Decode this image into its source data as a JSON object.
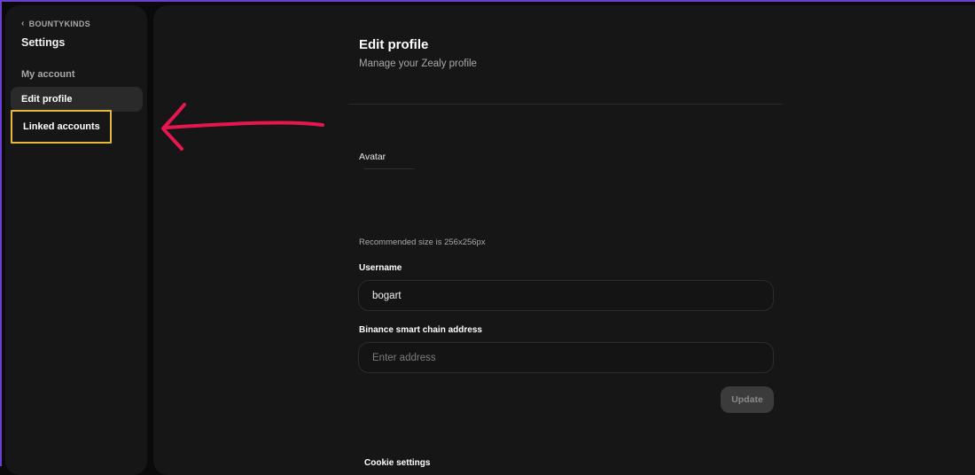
{
  "sidebar": {
    "back_label": "BOUNTYKINDS",
    "title": "Settings",
    "items": [
      {
        "label": "My account"
      },
      {
        "label": "Edit profile"
      },
      {
        "label": "Linked accounts"
      }
    ]
  },
  "main": {
    "title": "Edit profile",
    "subtitle": "Manage your Zealy profile",
    "avatar_label": "Avatar",
    "recommended_size": "Recommended size is 256x256px",
    "username": {
      "label": "Username",
      "value": "bogart"
    },
    "bsc_address": {
      "label": "Binance smart chain address",
      "placeholder": "Enter address"
    },
    "update_label": "Update",
    "cookie_settings": "Cookie settings"
  },
  "colors": {
    "highlight_box": "#e6b83a",
    "arrow": "#e8154f",
    "frame": "#6b3fd6"
  },
  "icons": [
    "chevron-left-icon",
    "annotation-arrow"
  ]
}
